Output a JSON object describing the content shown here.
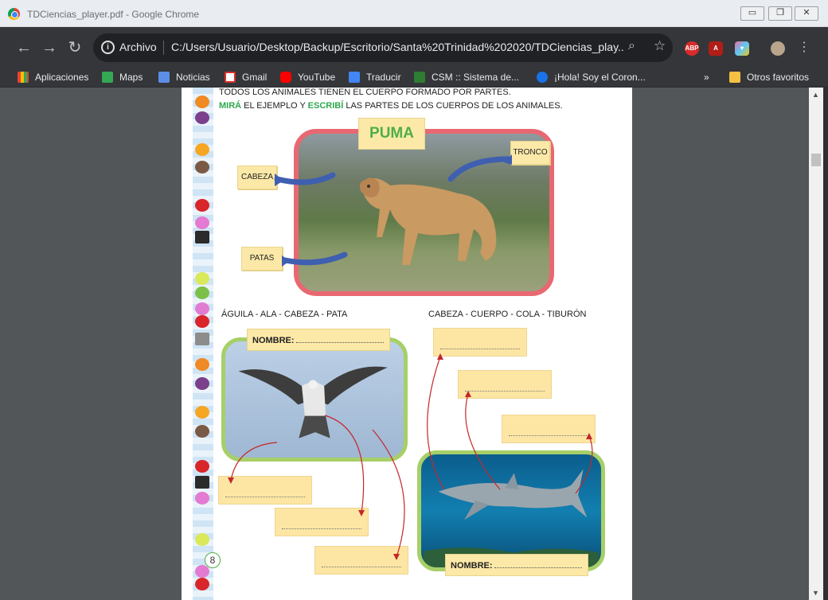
{
  "window": {
    "title": "TDCiencias_player.pdf - Google Chrome"
  },
  "toolbar": {
    "site_label": "Archivo",
    "url": "C:/Users/Usuario/Desktop/Backup/Escritorio/Santa%20Trinidad%202020/TDCiencias_play..."
  },
  "extensions": {
    "abp": "ABP"
  },
  "bookmarks": {
    "items": [
      {
        "label": "Aplicaciones"
      },
      {
        "label": "Maps"
      },
      {
        "label": "Noticias"
      },
      {
        "label": "Gmail"
      },
      {
        "label": "YouTube"
      },
      {
        "label": "Traducir"
      },
      {
        "label": "CSM :: Sistema de..."
      },
      {
        "label": "¡Hola! Soy el Coron..."
      }
    ],
    "overflow": "»",
    "others": "Otros favoritos"
  },
  "page": {
    "intro": "TODOS LOS ANIMALES TIENEN EL CUERPO FORMADO POR PARTES.",
    "instruction_word1": "MIRÁ",
    "instruction_mid": " EL EJEMPLO Y ",
    "instruction_word2": "ESCRIBÍ",
    "instruction_end": " LAS PARTES DE LOS CUERPOS DE LOS ANIMALES.",
    "puma_title": "PUMA",
    "labels": {
      "cabeza": "CABEZA",
      "tronco": "TRONCO",
      "patas": "PATAS"
    },
    "eagle_words": "ÁGUILA - ALA - CABEZA - PATA",
    "shark_words": "CABEZA - CUERPO - COLA - TIBURÓN",
    "nombre_label": "NOMBRE:",
    "page_number": "8"
  }
}
